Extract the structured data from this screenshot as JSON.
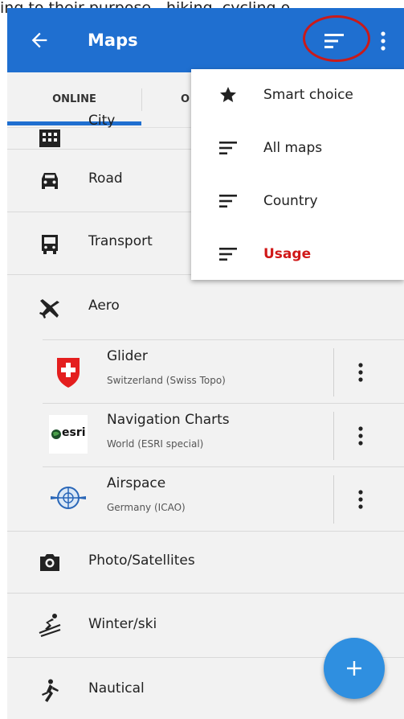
{
  "caption": {
    "text": "ing to their purpose - hiking, cycling o"
  },
  "appbar": {
    "title": "Maps",
    "bg_color": "#1f6fd0",
    "highlight_color": "#c91a1a"
  },
  "tabs": [
    {
      "label": "ONLINE",
      "selected": true
    },
    {
      "label": "O",
      "selected": false
    }
  ],
  "categories": {
    "city": "City",
    "road": "Road",
    "transport": "Transport",
    "aero": "Aero",
    "photo": "Photo/Satellites",
    "winter": "Winter/ski",
    "nautical": "Nautical"
  },
  "aero_maps": [
    {
      "name": "Glider",
      "desc": "Switzerland (Swiss Topo)",
      "logo": "swiss-flag-icon"
    },
    {
      "name": "Navigation Charts",
      "desc": "World (ESRI special)",
      "logo": "esri-logo",
      "logo_text": "esri"
    },
    {
      "name": "Airspace",
      "desc": "Germany (ICAO)",
      "logo": "icao-logo"
    }
  ],
  "sort_menu": {
    "items": [
      {
        "label": "Smart choice",
        "icon": "star-icon",
        "active": false
      },
      {
        "label": "All maps",
        "icon": "sort-icon",
        "active": false
      },
      {
        "label": "Country",
        "icon": "sort-icon",
        "active": false
      },
      {
        "label": "Usage",
        "icon": "sort-icon",
        "active": true
      }
    ],
    "active_color": "#d01818"
  },
  "fab": {
    "icon": "plus-icon",
    "color": "#2f8fe0"
  }
}
